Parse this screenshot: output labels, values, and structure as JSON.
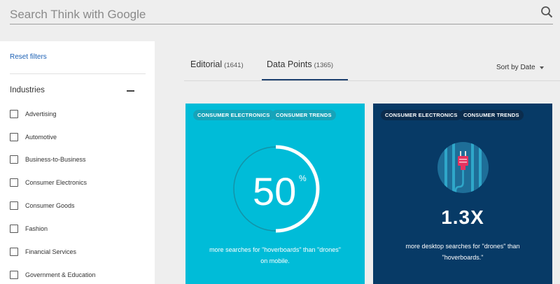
{
  "search": {
    "placeholder": "Search Think with Google"
  },
  "sidebar": {
    "reset_label": "Reset filters",
    "section_title": "Industries",
    "items": [
      {
        "label": "Advertising"
      },
      {
        "label": "Automotive"
      },
      {
        "label": "Business-to-Business"
      },
      {
        "label": "Consumer Electronics"
      },
      {
        "label": "Consumer Goods"
      },
      {
        "label": "Fashion"
      },
      {
        "label": "Financial Services"
      },
      {
        "label": "Government & Education"
      }
    ]
  },
  "tabs": [
    {
      "label": "Editorial",
      "count": "(1641)"
    },
    {
      "label": "Data Points",
      "count": "(1365)",
      "active": true
    }
  ],
  "sort": {
    "label": "Sort by Date"
  },
  "cards": [
    {
      "tags": [
        "CONSUMER ELECTRONICS",
        "CONSUMER TRENDS"
      ],
      "stat_value": "50",
      "stat_unit": "%",
      "ring_fraction": 0.5,
      "description_line1": "more searches for \"hoverboards\" than \"drones\"",
      "description_line2": "on mobile.",
      "color": "#00bcd8"
    },
    {
      "tags": [
        "CONSUMER ELECTRONICS",
        "CONSUMER TRENDS"
      ],
      "stat_value": "1.3X",
      "icon": "plug-icon",
      "description_line1": "more desktop searches for \"drones\" than",
      "description_line2": "\"hoverboards.\"",
      "color": "#073a66"
    }
  ],
  "colors": {
    "accent": "#1c3f6e",
    "link": "#1a5fb4",
    "plug": "#e5335f"
  }
}
